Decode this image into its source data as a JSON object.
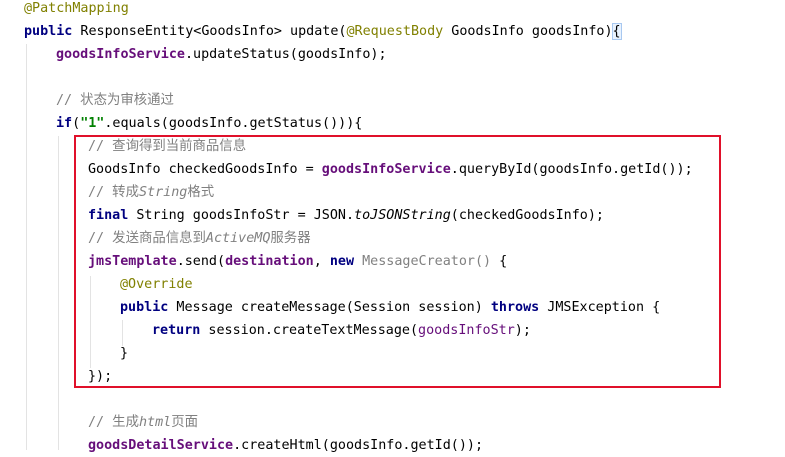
{
  "code": {
    "l0": "@PatchMapping",
    "l1": {
      "kw": "public",
      "sig": " ResponseEntity<GoodsInfo> update(",
      "ann": "@RequestBody",
      "params": " GoodsInfo goodsInfo)",
      "brace": "{"
    },
    "l2": {
      "field": "goodsInfoService",
      "rest": ".updateStatus(goodsInfo);"
    },
    "l4": "// 状态为审核通过",
    "l5": {
      "kw": "if",
      "open": "(",
      "str": "\"1\"",
      "rest": ".equals(goodsInfo.getStatus())){"
    },
    "l6": "// 查询得到当前商品信息",
    "l7": {
      "a": "GoodsInfo checkedGoodsInfo = ",
      "field": "goodsInfoService",
      "b": ".queryById(goodsInfo.getId());"
    },
    "l8": {
      "a": "// 转成",
      "b": "String",
      "c": "格式"
    },
    "l9": {
      "kw": "final",
      "a": " String goodsInfoStr = JSON.",
      "it": "toJSONString",
      "b": "(checkedGoodsInfo);"
    },
    "l10": {
      "a": "// 发送商品信息到",
      "b": "ActiveMQ",
      "c": "服务器"
    },
    "l11": {
      "field": "jmsTemplate",
      "a": ".send(",
      "field2": "destination",
      "b": ", ",
      "kw": "new",
      "c": " MessageCreator()",
      "d": " {"
    },
    "l12": "@Override",
    "l13": {
      "kw": "public",
      "a": " Message createMessage(Session session) ",
      "kw2": "throws",
      "b": " JMSException {"
    },
    "l14": {
      "kw": "return",
      "a": " session.createTextMessage(",
      "var": "goodsInfoStr",
      "b": ");"
    },
    "l15": "}",
    "l16": "});",
    "l18": {
      "a": "// 生成",
      "b": "html",
      "c": "页面"
    },
    "l19": {
      "field": "goodsDetailService",
      "a": ".createHtml(goodsInfo.getId());"
    }
  },
  "highlight_color": "#e0102a"
}
